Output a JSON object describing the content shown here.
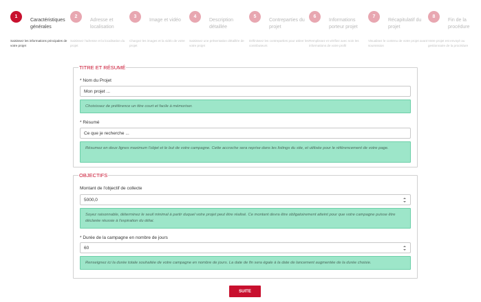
{
  "steps": [
    {
      "num": "1",
      "title": "Caractéristiques générales",
      "desc": "Saisissez les informations principales de votre projet"
    },
    {
      "num": "2",
      "title": "Adresse et localisation",
      "desc": "Saisissez l'adresse et la localisation du projet"
    },
    {
      "num": "3",
      "title": "Image et vidéo",
      "desc": "Chargez les images et la vidéo de votre projet"
    },
    {
      "num": "4",
      "title": "Description détaillée",
      "desc": "Saisissez une présentation détaillée de votre projet"
    },
    {
      "num": "5",
      "title": "Contreparties du projet",
      "desc": "Définissez les contreparties pour attirer les contributeurs"
    },
    {
      "num": "6",
      "title": "Informations porteur projet",
      "desc": "Remplissez et vérifiez avec soin les informations de votre profil"
    },
    {
      "num": "7",
      "title": "Récapitulatif du projet",
      "desc": "Visualisez le contenu de votre projet avant soumission"
    },
    {
      "num": "8",
      "title": "Fin de la procédure",
      "desc": "Votre projet est envoyé au gestionnaire de la procédure"
    }
  ],
  "section_titre": {
    "legend": "TITRE ET RÉSUMÉ",
    "nom_label": "* Nom du Projet",
    "nom_value": "Mon projet ...",
    "nom_help": "Choisissez de préférence un titre court et facile à mémoriser.",
    "resume_label": "* Résumé",
    "resume_value": "Ce que je recherche ...",
    "resume_help": "Résumez en deux lignes maximum l'objet et le but de votre campagne. Cette accroche sera reprise dans les listings du site, et utilisée pour le référencement de votre page."
  },
  "section_objectifs": {
    "legend": "OBJECTIFS",
    "montant_label": "Montant de l'objectif de collecte",
    "montant_value": "5000,0",
    "montant_help": "Soyez raisonnable, déterminez le seuil minimal à partir duquel votre projet peut être réalisé. Ce montant devra être obligatoirement atteint pour que votre campagne puisse être déclarée réussie à l'expiration du délai.",
    "duree_label": "* Durée de la campagne en nombre de jours",
    "duree_value": "60",
    "duree_help": "Renseignez ici la durée totale souhaitée de votre campagne en nombre de jours. La date de fin sera égale à la date de lancement augmentée de la durée choisie."
  },
  "submit_label": "SUITE",
  "colors": {
    "accent": "#c8102e",
    "help_bg": "#9de6c9"
  }
}
